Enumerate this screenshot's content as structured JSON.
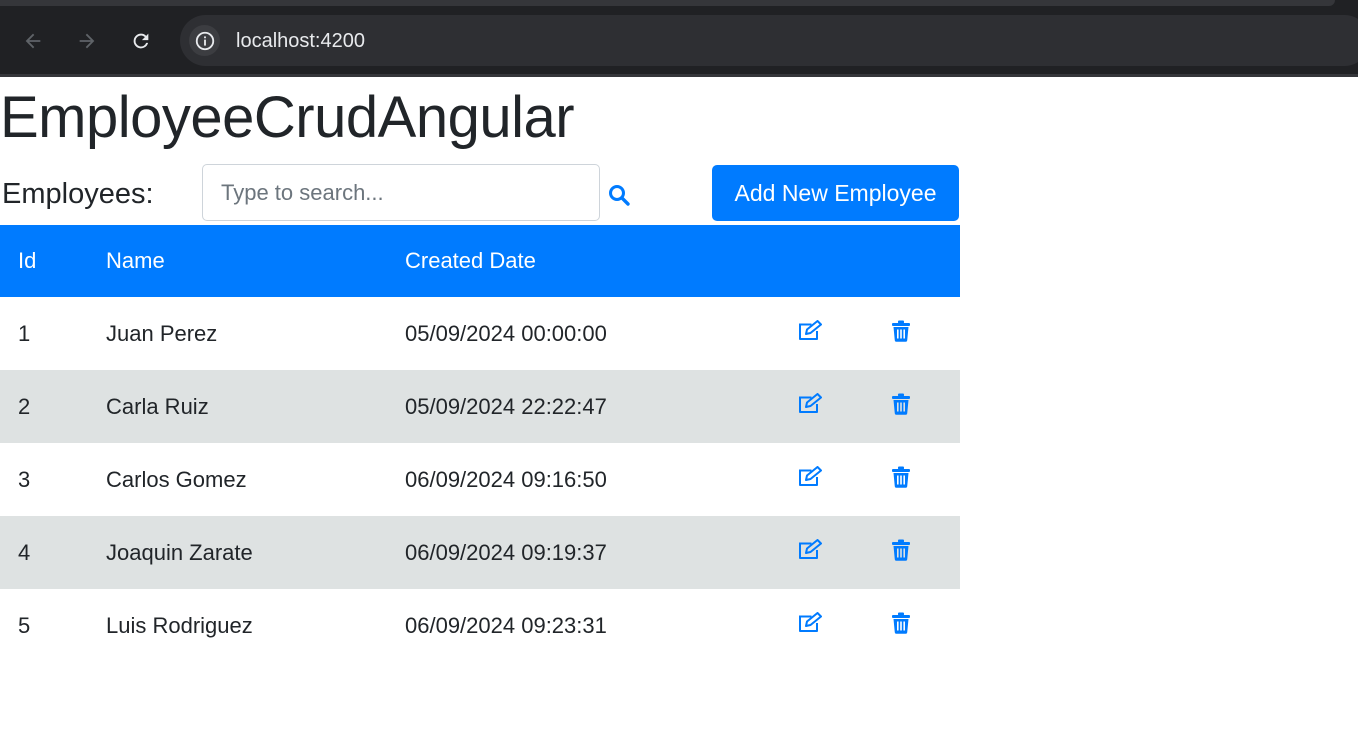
{
  "browser": {
    "url": "localhost:4200",
    "back_icon": "arrow-left-icon",
    "forward_icon": "arrow-right-icon",
    "reload_icon": "reload-icon",
    "info_icon": "info-icon"
  },
  "app": {
    "title": "EmployeeCrudAngular"
  },
  "toolbar": {
    "label": "Employees:",
    "search_placeholder": "Type to search...",
    "search_value": "",
    "search_icon": "search-icon",
    "add_button_label": "Add New Employee"
  },
  "table": {
    "columns": [
      "Id",
      "Name",
      "Created Date",
      "",
      ""
    ],
    "rows": [
      {
        "id": "1",
        "name": "Juan Perez",
        "created": "05/09/2024 00:00:00"
      },
      {
        "id": "2",
        "name": "Carla Ruiz",
        "created": "05/09/2024 22:22:47"
      },
      {
        "id": "3",
        "name": "Carlos Gomez",
        "created": "06/09/2024 09:16:50"
      },
      {
        "id": "4",
        "name": "Joaquin Zarate",
        "created": "06/09/2024 09:19:37"
      },
      {
        "id": "5",
        "name": "Luis Rodriguez",
        "created": "06/09/2024 09:23:31"
      }
    ],
    "row_icons": {
      "edit": "edit-icon",
      "delete": "trash-icon"
    }
  },
  "colors": {
    "accent": "#007bff",
    "stripe": "#dee2e2",
    "chrome_bg": "#202124"
  }
}
